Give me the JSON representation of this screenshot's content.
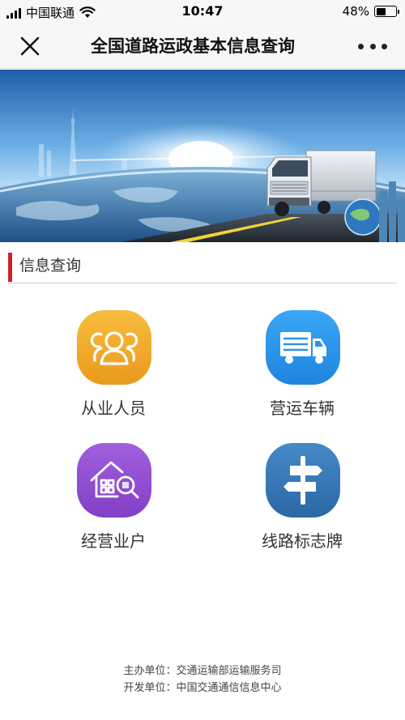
{
  "status_bar": {
    "carrier": "中国联通",
    "time": "10:47",
    "battery": "48%",
    "battery_level": 0.48,
    "signal_icon": "cellular-signal-icon",
    "wifi_icon": "wifi-icon"
  },
  "nav": {
    "title": "全国道路运政基本信息查询",
    "close_icon": "close-icon",
    "more_icon": "more-icon"
  },
  "banner": {
    "image": "truck-earth-banner"
  },
  "section": {
    "title": "信息查询",
    "accent_color": "#d22222"
  },
  "menu": [
    {
      "label": "从业人员",
      "icon": "people-icon",
      "color": "#f1a72a"
    },
    {
      "label": "营运车辆",
      "icon": "truck-icon",
      "color": "#2e95ea"
    },
    {
      "label": "经营业户",
      "icon": "house-search-icon",
      "color": "#8f4fd1"
    },
    {
      "label": "线路标志牌",
      "icon": "signpost-icon",
      "color": "#3577b6"
    }
  ],
  "footer": {
    "sponsor": "主办单位：交通运输部运输服务司",
    "developer": "开发单位：中国交通通信信息中心"
  }
}
